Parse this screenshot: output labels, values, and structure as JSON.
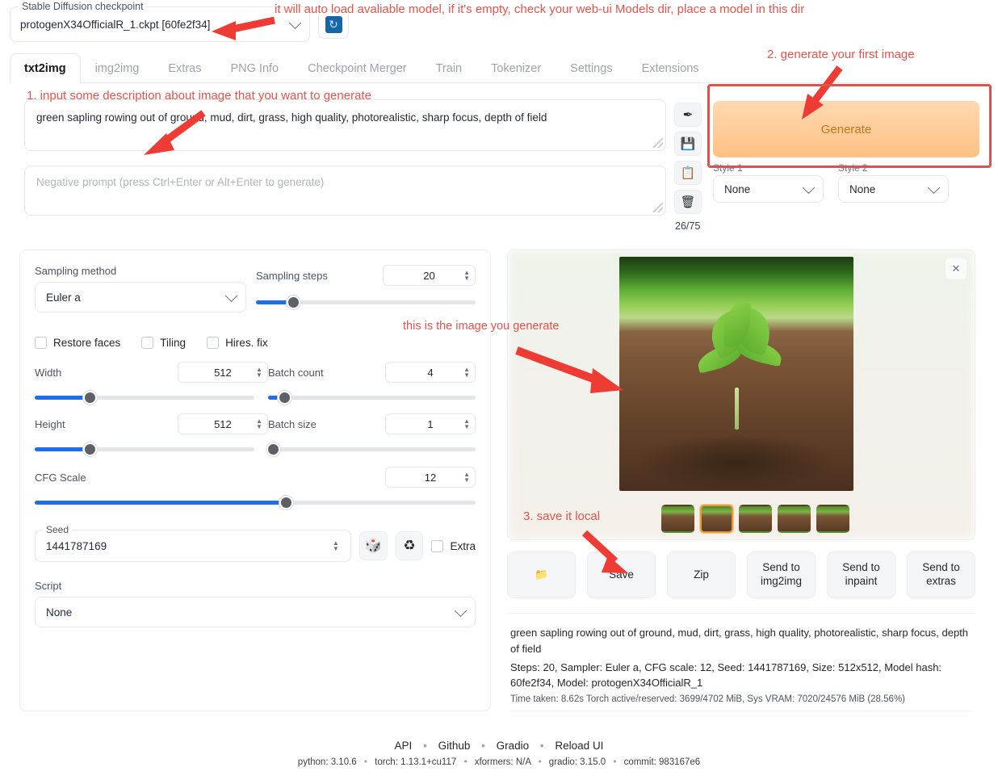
{
  "checkpoint": {
    "label": "Stable Diffusion checkpoint",
    "value": "protogenX34OfficialR_1.ckpt [60fe2f34]",
    "refresh_icon": "refresh-icon"
  },
  "tabs": [
    {
      "label": "txt2img",
      "active": true
    },
    {
      "label": "img2img",
      "active": false
    },
    {
      "label": "Extras",
      "active": false
    },
    {
      "label": "PNG Info",
      "active": false
    },
    {
      "label": "Checkpoint Merger",
      "active": false
    },
    {
      "label": "Train",
      "active": false
    },
    {
      "label": "Tokenizer",
      "active": false
    },
    {
      "label": "Settings",
      "active": false
    },
    {
      "label": "Extensions",
      "active": false
    }
  ],
  "prompt": {
    "value": "green sapling rowing out of ground, mud, dirt, grass, high quality, photorealistic, sharp focus, depth of field",
    "negative_placeholder": "Negative prompt (press Ctrl+Enter or Alt+Enter to generate)",
    "token_count": "26/75"
  },
  "prompt_icons": [
    {
      "name": "pen-icon",
      "glyph": "✒"
    },
    {
      "name": "save-style-icon",
      "glyph": "💾"
    },
    {
      "name": "paste-icon",
      "glyph": "📋"
    },
    {
      "name": "trash-icon",
      "glyph": "🗑"
    }
  ],
  "generate": {
    "label": "Generate"
  },
  "styles": [
    {
      "label": "Style 1",
      "value": "None"
    },
    {
      "label": "Style 2",
      "value": "None"
    }
  ],
  "settings": {
    "sampling_method": {
      "label": "Sampling method",
      "value": "Euler a"
    },
    "sampling_steps": {
      "label": "Sampling steps",
      "value": "20",
      "fill_pct": 17
    },
    "checkboxes": [
      {
        "label": "Restore faces",
        "checked": false
      },
      {
        "label": "Tiling",
        "checked": false
      },
      {
        "label": "Hires. fix",
        "checked": false
      }
    ],
    "width": {
      "label": "Width",
      "value": "512",
      "fill_pct": 25
    },
    "height": {
      "label": "Height",
      "value": "512",
      "fill_pct": 25
    },
    "batch_count": {
      "label": "Batch count",
      "value": "4",
      "fill_pct": 7
    },
    "batch_size": {
      "label": "Batch size",
      "value": "1",
      "fill_pct": 1
    },
    "cfg_scale": {
      "label": "CFG Scale",
      "value": "12",
      "fill_pct": 57
    },
    "seed": {
      "label": "Seed",
      "value": "1441787169"
    },
    "seed_buttons": [
      {
        "name": "dice-icon",
        "glyph": "🎲"
      },
      {
        "name": "recycle-icon",
        "glyph": "♻"
      }
    ],
    "extra_checkbox": {
      "label": "Extra",
      "checked": false
    },
    "script": {
      "label": "Script",
      "value": "None"
    }
  },
  "result": {
    "close_icon": "close-icon",
    "thumbnail_count": 5,
    "selected_thumbnail": 1,
    "actions": [
      {
        "name": "open-folder-button",
        "label": "📁",
        "is_icon": true
      },
      {
        "name": "save-button",
        "label": "Save",
        "is_icon": false
      },
      {
        "name": "zip-button",
        "label": "Zip",
        "is_icon": false
      },
      {
        "name": "send-to-img2img-button",
        "label": "Send to\nimg2img",
        "is_icon": false
      },
      {
        "name": "send-to-inpaint-button",
        "label": "Send to\ninpaint",
        "is_icon": false
      },
      {
        "name": "send-to-extras-button",
        "label": "Send to\nextras",
        "is_icon": false
      }
    ],
    "info_prompt": "green sapling rowing out of ground, mud, dirt, grass, high quality, photorealistic, sharp focus, depth of field",
    "info_params": "Steps: 20, Sampler: Euler a, CFG scale: 12, Seed: 1441787169, Size: 512x512, Model hash: 60fe2f34, Model: protogenX34OfficialR_1",
    "info_time": "Time taken: 8.62s  Torch active/reserved: 3699/4702 MiB, Sys VRAM: 7020/24576 MiB (28.56%)"
  },
  "footer": {
    "links": [
      "API",
      "Github",
      "Gradio",
      "Reload UI"
    ],
    "versions": [
      "python: 3.10.6",
      "torch: 1.13.1+cu117",
      "xformers: N/A",
      "gradio: 3.15.0",
      "commit: 983167e6"
    ]
  },
  "annotations": [
    {
      "id": "a0",
      "text": "it will auto load avaliable model, if it's empty, check your web-ui Models dir, place a model in this dir"
    },
    {
      "id": "a1",
      "text": "1. input some description about image that you want to generate"
    },
    {
      "id": "a2",
      "text": "2. generate your first image"
    },
    {
      "id": "a3",
      "text": "this is the image you generate"
    },
    {
      "id": "a4",
      "text": "3. save it local"
    }
  ],
  "colors": {
    "annotation_red": "#e0554e",
    "highlight_red": "#d9534f",
    "slider_blue": "#1f6feb",
    "generate_orange": "#ffc184",
    "thumb_selected": "#e79a3c"
  }
}
